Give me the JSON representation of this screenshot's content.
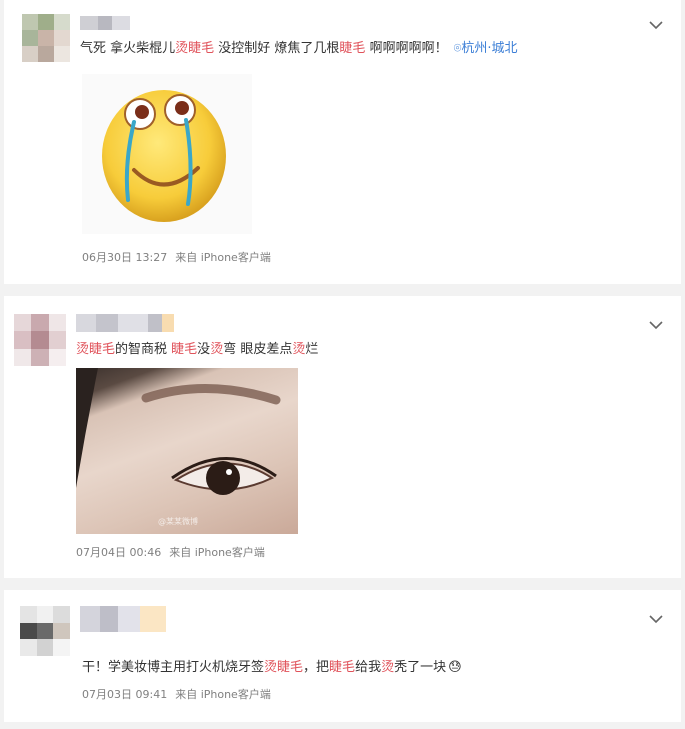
{
  "posts": [
    {
      "segments": [
        {
          "t": "气死 拿火柴棍儿"
        },
        {
          "t": "烫睫毛",
          "hl": true
        },
        {
          "t": " 没控制好 燎焦了几根"
        },
        {
          "t": "睫毛",
          "hl": true
        },
        {
          "t": " 啊啊啊啊啊！"
        }
      ],
      "location": "杭州·城北",
      "date": "06月30日 13:27",
      "source": "来自 iPhone客户端"
    },
    {
      "segments": [
        {
          "t": "烫睫毛",
          "hl": true
        },
        {
          "t": "的智商税 "
        },
        {
          "t": "睫毛",
          "hl": true
        },
        {
          "t": "没"
        },
        {
          "t": "烫",
          "hl": true
        },
        {
          "t": "弯 眼皮差点"
        },
        {
          "t": "烫",
          "hl": true
        },
        {
          "t": "烂"
        }
      ],
      "image_watermark": "@某某微博",
      "date": "07月04日 00:46",
      "source": "来自 iPhone客户端"
    },
    {
      "segments": [
        {
          "t": "干！学美妆博主用打火机烧牙签"
        },
        {
          "t": "烫睫毛",
          "hl": true
        },
        {
          "t": "，把"
        },
        {
          "t": "睫毛",
          "hl": true
        },
        {
          "t": "给我"
        },
        {
          "t": "烫",
          "hl": true
        },
        {
          "t": "秃了一块"
        }
      ],
      "emoji": "😓",
      "date": "07月03日 09:41",
      "source": "来自 iPhone客户端"
    }
  ],
  "icons": {
    "more": "chevron-down-icon",
    "location": "location-pin-icon"
  },
  "colors": {
    "highlight": "#e0525a",
    "link": "#3b7ed6",
    "meta": "#808080"
  }
}
